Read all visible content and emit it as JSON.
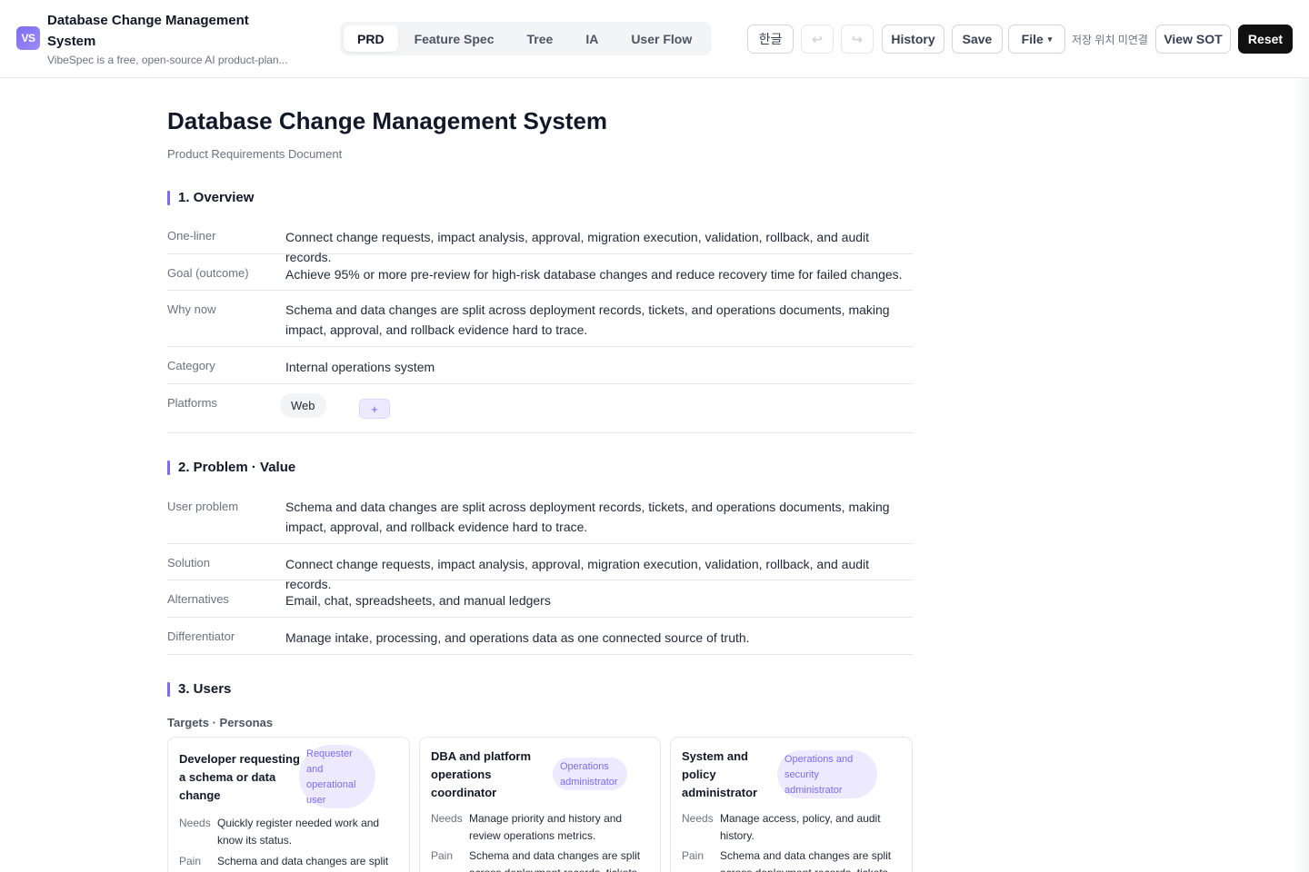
{
  "header": {
    "logo_text": "VS",
    "title": "Database Change Management System",
    "subtitle": "VibeSpec is a free, open-source AI product-plan...",
    "tabs": [
      "PRD",
      "Feature Spec",
      "Tree",
      "IA",
      "User Flow"
    ],
    "active_tab": "PRD",
    "lang_label": "한글",
    "undo_icon": "↩",
    "redo_icon": "↪",
    "history_label": "History",
    "save_label": "Save",
    "file_label": "File",
    "file_caret": "▾",
    "storage_status": "저장 위치 미연결",
    "view_sot_label": "View SOT",
    "reset_label": "Reset"
  },
  "doc": {
    "title": "Database Change Management System",
    "subtitle": "Product Requirements Document",
    "overview": {
      "heading": "1. Overview",
      "one_liner_label": "One-liner",
      "one_liner": "Connect change requests, impact analysis, approval, migration execution, validation, rollback, and audit records.",
      "goal_label": "Goal (outcome)",
      "goal": "Achieve 95% or more pre-review for high-risk database changes and reduce recovery time for failed changes.",
      "why_label": "Why now",
      "why": "Schema and data changes are split across deployment records, tickets, and operations documents, making impact, approval, and rollback evidence hard to trace.",
      "category_label": "Category",
      "category": "Internal operations system",
      "platforms_label": "Platforms",
      "platforms": [
        "Web"
      ],
      "add_label": "+"
    },
    "problem": {
      "heading": "2. Problem · Value",
      "user_problem_label": "User problem",
      "user_problem": "Schema and data changes are split across deployment records, tickets, and operations documents, making impact, approval, and rollback evidence hard to trace.",
      "solution_label": "Solution",
      "solution": "Connect change requests, impact analysis, approval, migration execution, validation, rollback, and audit records.",
      "alternatives_label": "Alternatives",
      "alternatives": "Email, chat, spreadsheets, and manual ledgers",
      "differentiator_label": "Differentiator",
      "differentiator": "Manage intake, processing, and operations data as one connected source of truth."
    },
    "users": {
      "heading": "3. Users",
      "subheading": "Targets · Personas",
      "needs_label": "Needs",
      "pain_label": "Pain",
      "personas": [
        {
          "name": "Developer requesting a schema or data change",
          "role": "Requester and operational user",
          "needs": "Quickly register needed work and know its status.",
          "pain": "Schema and data changes are split across deployment records, tickets"
        },
        {
          "name": "DBA and platform operations coordinator",
          "role": "Operations administrator",
          "needs": "Manage priority and history and review operations metrics.",
          "pain": "Schema and data changes are split across deployment records, tickets"
        },
        {
          "name": "System and policy administrator",
          "role": "Operations and security administrator",
          "needs": "Manage access, policy, and audit history.",
          "pain": "Schema and data changes are split across deployment records, tickets"
        }
      ]
    }
  }
}
